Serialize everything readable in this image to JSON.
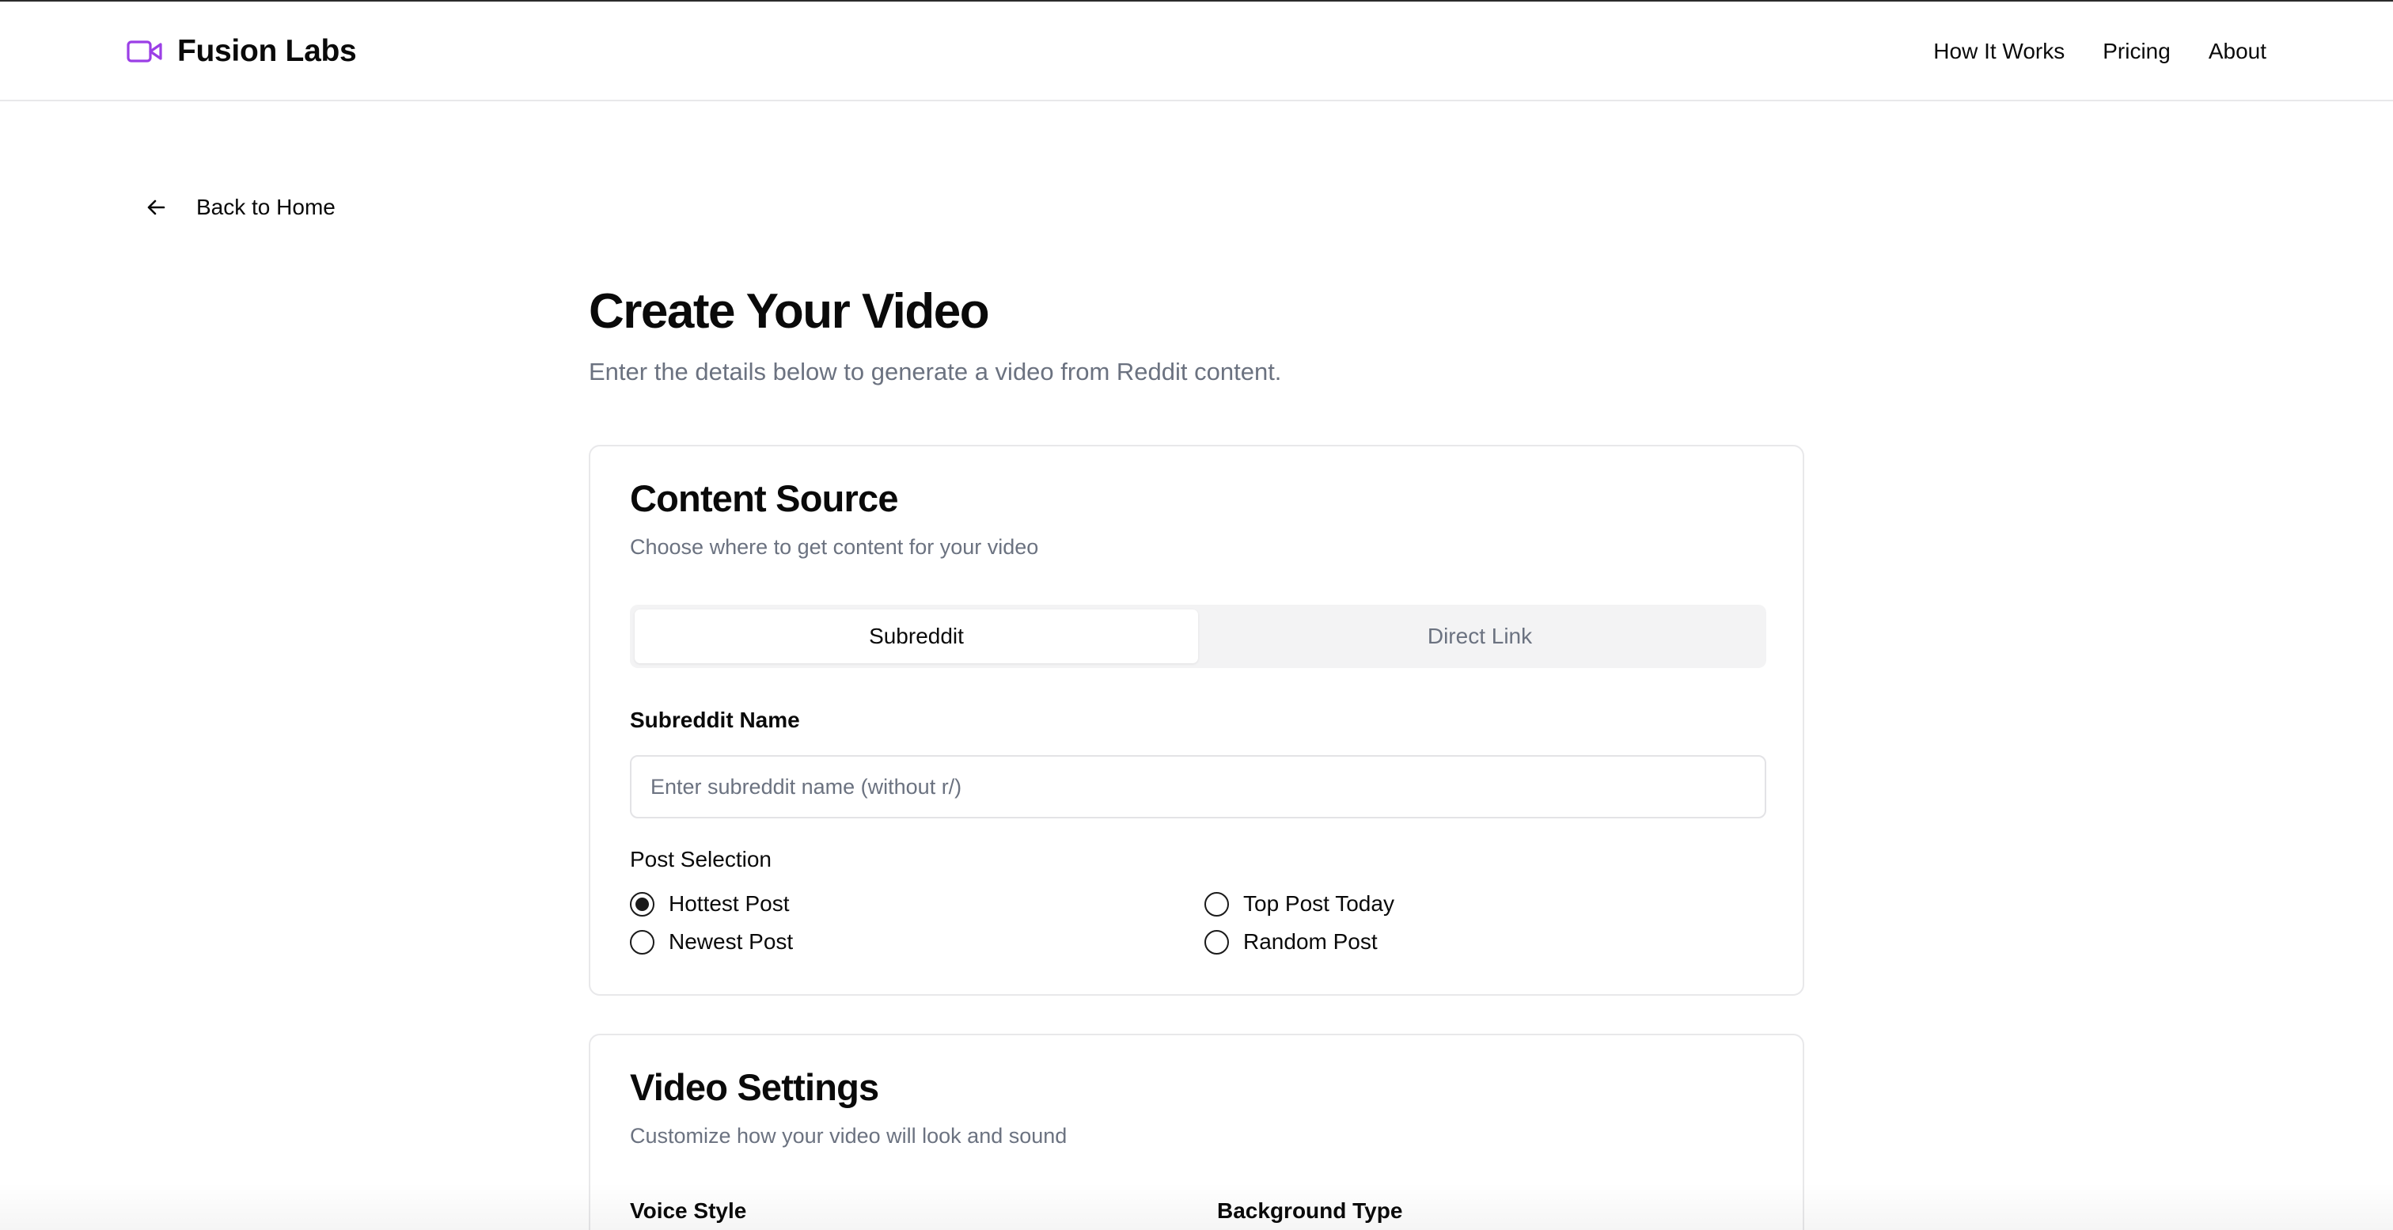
{
  "header": {
    "brand_name": "Fusion Labs",
    "brand_icon": "video-camera-icon",
    "brand_color": "#9b3fe6",
    "nav": [
      "How It Works",
      "Pricing",
      "About"
    ]
  },
  "back_link": {
    "label": "Back to Home",
    "icon": "arrow-left-icon"
  },
  "page": {
    "title": "Create Your Video",
    "subtitle": "Enter the details below to generate a video from Reddit content."
  },
  "content_source": {
    "title": "Content Source",
    "description": "Choose where to get content for your video",
    "tabs": [
      {
        "label": "Subreddit",
        "active": true
      },
      {
        "label": "Direct Link",
        "active": false
      }
    ],
    "subreddit_label": "Subreddit Name",
    "subreddit_value": "",
    "subreddit_placeholder": "Enter subreddit name (without r/)",
    "post_selection_label": "Post Selection",
    "options": [
      {
        "label": "Hottest Post",
        "selected": true
      },
      {
        "label": "Top Post Today",
        "selected": false
      },
      {
        "label": "Newest Post",
        "selected": false
      },
      {
        "label": "Random Post",
        "selected": false
      }
    ]
  },
  "video_settings": {
    "title": "Video Settings",
    "description": "Customize how your video will look and sound",
    "voice_label": "Voice Style",
    "background_label": "Background Type"
  }
}
